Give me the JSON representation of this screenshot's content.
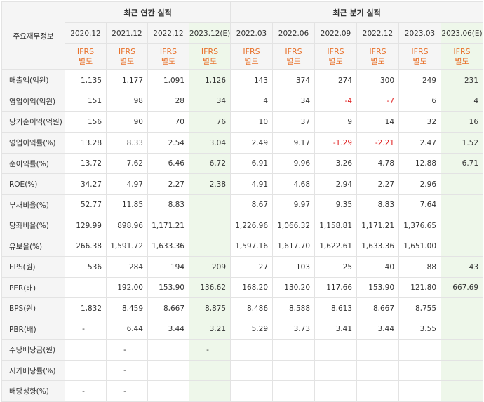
{
  "header": {
    "item_label": "주요재무정보",
    "annual_group": "최근 연간 실적",
    "quarterly_group": "최근 분기 실적",
    "annual_periods": [
      "2020.12",
      "2021.12",
      "2022.12",
      "2023.12(E)"
    ],
    "quarterly_periods": [
      "2022.03",
      "2022.06",
      "2022.09",
      "2022.12",
      "2023.03",
      "2023.06(E)"
    ],
    "ifrs_line1": "IFRS",
    "ifrs_line2": "별도"
  },
  "rows": [
    {
      "label": "매출액(억원)",
      "values": [
        "1,135",
        "1,177",
        "1,091",
        "1,126",
        "143",
        "374",
        "274",
        "300",
        "249",
        "231"
      ]
    },
    {
      "label": "영업이익(억원)",
      "values": [
        "151",
        "98",
        "28",
        "34",
        "4",
        "34",
        "-4",
        "-7",
        "6",
        "4"
      ]
    },
    {
      "label": "당기순이익(억원)",
      "values": [
        "156",
        "90",
        "70",
        "76",
        "10",
        "37",
        "9",
        "14",
        "32",
        "16"
      ]
    },
    {
      "label": "영업이익률(%)",
      "values": [
        "13.28",
        "8.33",
        "2.54",
        "3.04",
        "2.49",
        "9.17",
        "-1.29",
        "-2.21",
        "2.47",
        "1.52"
      ]
    },
    {
      "label": "순이익률(%)",
      "values": [
        "13.72",
        "7.62",
        "6.46",
        "6.72",
        "6.91",
        "9.96",
        "3.26",
        "4.78",
        "12.88",
        "6.71"
      ]
    },
    {
      "label": "ROE(%)",
      "values": [
        "34.27",
        "4.97",
        "2.27",
        "2.38",
        "4.91",
        "4.68",
        "2.94",
        "2.27",
        "2.96",
        ""
      ]
    },
    {
      "label": "부채비율(%)",
      "values": [
        "52.77",
        "11.85",
        "8.83",
        "",
        "8.67",
        "9.97",
        "9.35",
        "8.83",
        "7.64",
        ""
      ]
    },
    {
      "label": "당좌비율(%)",
      "values": [
        "129.99",
        "898.96",
        "1,171.21",
        "",
        "1,226.96",
        "1,066.32",
        "1,158.81",
        "1,171.21",
        "1,376.65",
        ""
      ]
    },
    {
      "label": "유보율(%)",
      "values": [
        "266.38",
        "1,591.72",
        "1,633.36",
        "",
        "1,597.16",
        "1,617.70",
        "1,622.61",
        "1,633.36",
        "1,651.00",
        ""
      ]
    },
    {
      "label": "EPS(원)",
      "values": [
        "536",
        "284",
        "194",
        "209",
        "27",
        "103",
        "25",
        "40",
        "88",
        "43"
      ]
    },
    {
      "label": "PER(배)",
      "values": [
        "",
        "192.00",
        "153.90",
        "136.62",
        "168.20",
        "130.20",
        "117.66",
        "153.90",
        "121.80",
        "667.69"
      ]
    },
    {
      "label": "BPS(원)",
      "values": [
        "1,832",
        "8,459",
        "8,667",
        "8,875",
        "8,486",
        "8,588",
        "8,613",
        "8,667",
        "8,755",
        ""
      ]
    },
    {
      "label": "PBR(배)",
      "values": [
        "-",
        "6.44",
        "3.44",
        "3.21",
        "5.29",
        "3.73",
        "3.41",
        "3.44",
        "3.55",
        ""
      ]
    },
    {
      "label": "주당배당금(원)",
      "values": [
        "",
        "-",
        "",
        "-",
        "",
        "",
        "",
        "",
        "",
        ""
      ]
    },
    {
      "label": "시가배당률(%)",
      "values": [
        "",
        "-",
        "",
        "",
        "",
        "",
        "",
        "",
        "",
        ""
      ]
    },
    {
      "label": "배당성향(%)",
      "values": [
        "-",
        "-",
        "",
        "",
        "",
        "",
        "",
        "",
        "",
        ""
      ]
    }
  ],
  "colors": {
    "header_bg": "#f5f5f5",
    "estimate_bg": "#eef7ea",
    "ifrs_text": "#e8722c",
    "negative_text": "#e02020",
    "border": "#e3e3e3"
  }
}
